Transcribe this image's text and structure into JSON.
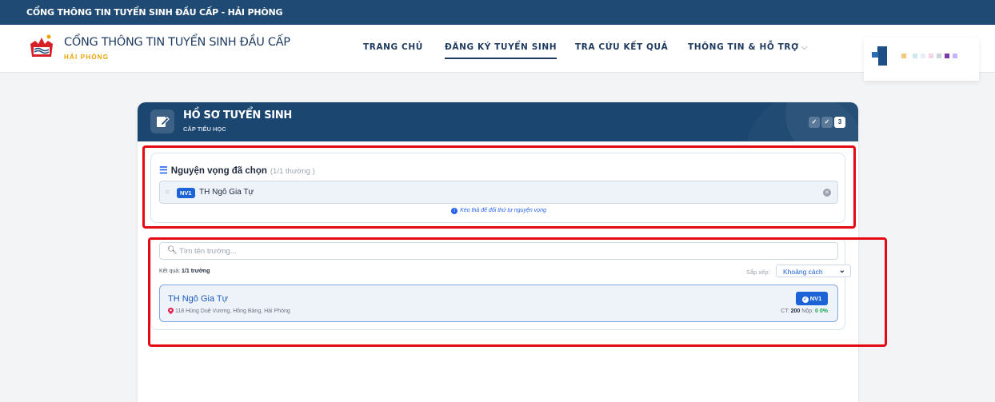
{
  "top_strip": {
    "text": "CỔNG THÔNG TIN TUYỂN SINH ĐẦU CẤP - HẢI PHÒNG"
  },
  "brand": {
    "title": "CỔNG THÔNG TIN TUYỂN SINH ĐẦU CẤP",
    "subtitle": "HẢI PHÒNG"
  },
  "nav": {
    "home": "TRANG CHỦ",
    "register": "ĐĂNG KÝ TUYỂN SINH",
    "lookup": "TRA CỨU KẾT QUẢ",
    "info": "THÔNG TIN & HỖ TRỢ",
    "active": "register"
  },
  "panel": {
    "title": "HỒ SƠ TUYỂN SINH",
    "subtitle": "CẤP TIỂU HỌC",
    "steps": [
      "✓",
      "✓",
      "3"
    ]
  },
  "wishes": {
    "title": "Nguyện vọng đã chọn",
    "count": "(1/1 thường )",
    "items": [
      {
        "badge": "NV1",
        "name": "TH Ngô Gia Tự"
      }
    ],
    "hint": "Kéo thả để đổi thứ tự nguyện vọng"
  },
  "search": {
    "placeholder": "Tìm tên trường...",
    "results_label": "Kết quả:",
    "results_value": "1/1 trường",
    "sort_label": "Sắp xếp:",
    "sort_value": "Khoảng cách"
  },
  "schools": [
    {
      "name": "TH Ngô Gia Tự",
      "address": "118 Hùng Duệ Vương, Hồng Bàng, Hải Phòng",
      "button": "NV1",
      "ct_label": "CT:",
      "ct_value": "200",
      "nop_label": "Nộp:",
      "nop_value": "0",
      "percent": "0%"
    }
  ],
  "colors": {
    "primary": "#1b4670",
    "accent": "#1d63d8",
    "highlight_border": "#e50914",
    "brand_orange": "#e8a400"
  }
}
